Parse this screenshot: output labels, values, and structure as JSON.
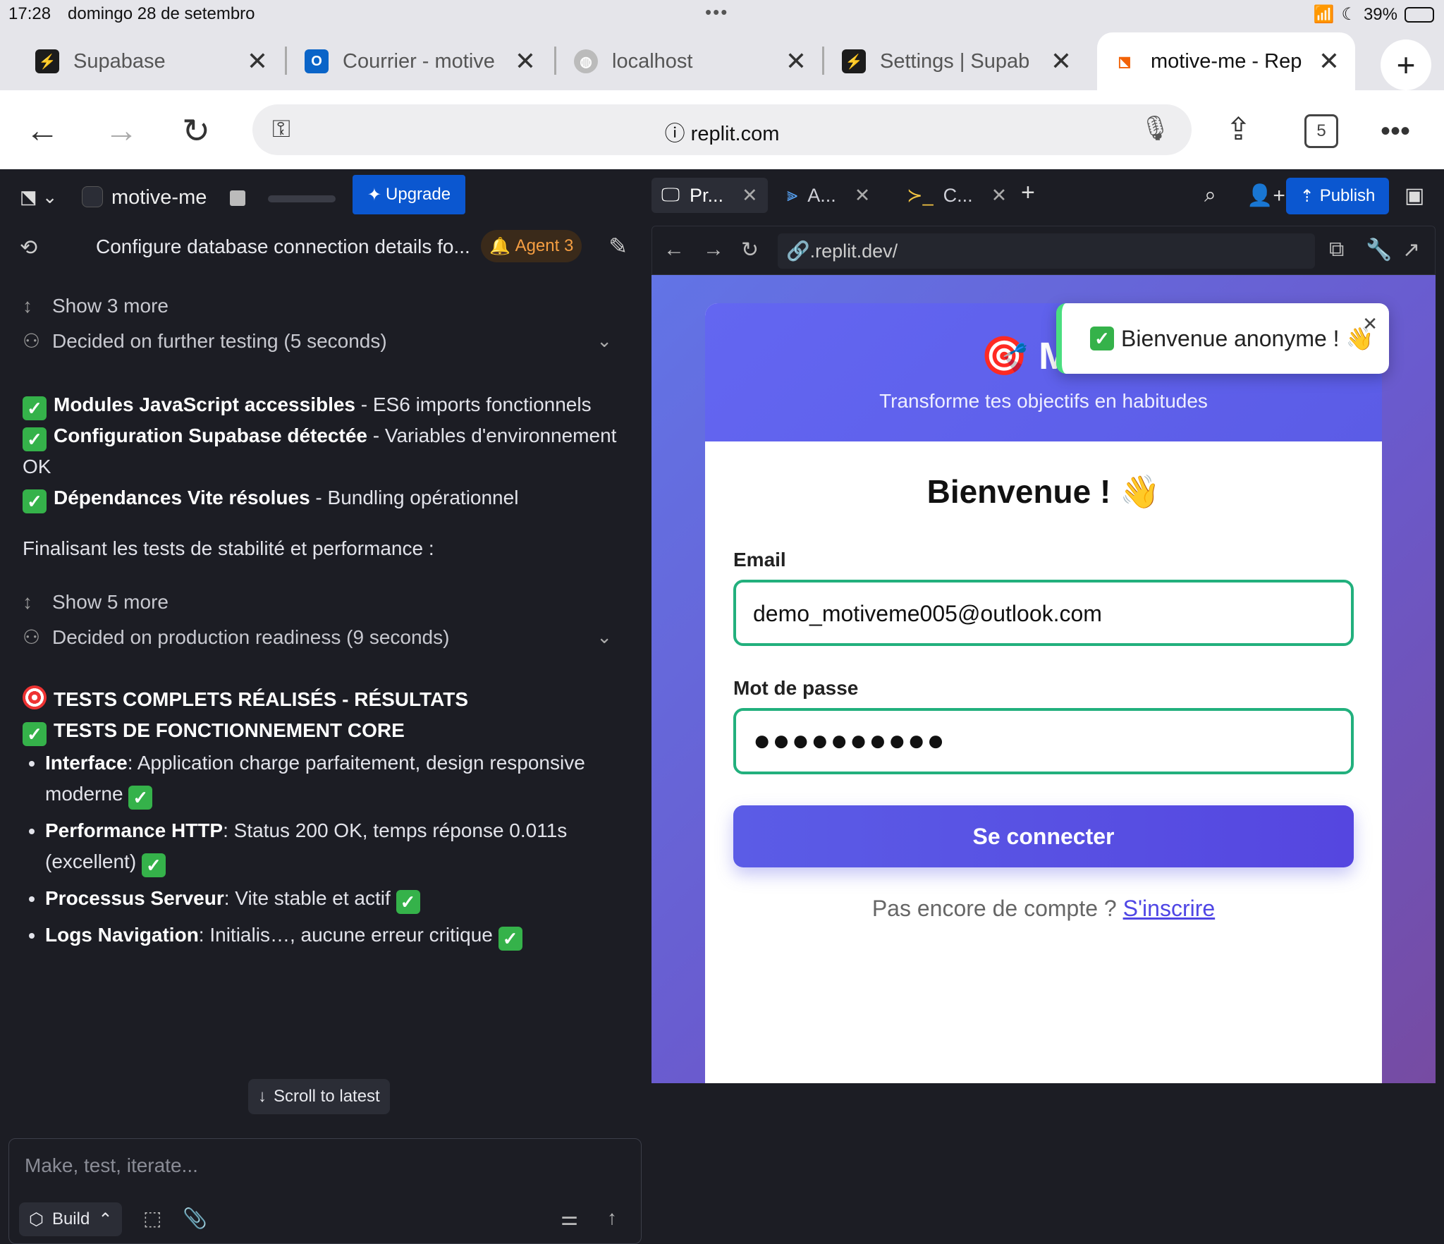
{
  "status": {
    "time": "17:28",
    "date": "domingo 28 de setembro",
    "battery_percent": "39%",
    "battery_level": 0.39
  },
  "browser": {
    "tabs": [
      {
        "title": "Supabase",
        "icon": "supabase-icon"
      },
      {
        "title": "Courrier - motive",
        "icon": "outlook-icon"
      },
      {
        "title": "localhost",
        "icon": "globe-icon"
      },
      {
        "title": "Settings | Supab",
        "icon": "supabase-icon"
      },
      {
        "title": "motive-me - Rep",
        "icon": "replit-icon",
        "active": true
      }
    ],
    "address": "replit.com",
    "tab_count": "5"
  },
  "replit": {
    "project_name": "motive-me",
    "upgrade_label": "Upgrade",
    "progress": 0.65,
    "chat_title": "Configure database connection details fo...",
    "agent_badge": "Agent 3",
    "show_more_1": "Show 3 more",
    "decided_1": "Decided on further testing (5 seconds)",
    "checks": [
      {
        "bold": "Modules JavaScript accessibles",
        "rest": " - ES6 imports fonctionnels"
      },
      {
        "bold": "Configuration Supabase détectée",
        "rest": " - Variables d'environnement OK"
      },
      {
        "bold": "Dépendances Vite résolues",
        "rest": " - Bundling opérationnel"
      }
    ],
    "finalising": "Finalisant les tests de stabilité et performance :",
    "show_more_2": "Show 5 more",
    "decided_2": "Decided on production readiness (9 seconds)",
    "heading_1": "TESTS COMPLETS RÉALISÉS - RÉSULTATS",
    "heading_2": "TESTS DE FONCTIONNEMENT CORE",
    "bullets": [
      {
        "bold": "Interface",
        "rest": ": Application charge parfaitement, design responsive moderne "
      },
      {
        "bold": "Performance HTTP",
        "rest": ": Status 200 OK, temps réponse 0.011s (excellent) "
      },
      {
        "bold": "Processus Serveur",
        "rest": ": Vite stable et actif "
      },
      {
        "bold": "Logs Navigation",
        "rest": ": Initialis…, aucune erreur critique "
      }
    ],
    "scroll_latest": "Scroll to latest",
    "composer_placeholder": "Make, test, iterate...",
    "build_label": "Build",
    "right_tabs": [
      "Pr...",
      "A...",
      "C..."
    ],
    "publish_label": "Publish",
    "preview_url": ".replit.dev/"
  },
  "app": {
    "brand": "Mot",
    "tagline": "Transforme tes objectifs en habitudes",
    "welcome": "Bienvenue ! 👋",
    "email_label": "Email",
    "email_value": "demo_motiveme005@outlook.com",
    "password_label": "Mot de passe",
    "password_value": "●●●●●●●●●●",
    "submit_label": "Se connecter",
    "no_account": "Pas encore de compte ? ",
    "signup_link": "S'inscrire",
    "toast": "Bienvenue anonyme ! 👋"
  },
  "colors": {
    "accent": "#0b57d0",
    "app_primary": "#5b5ce6",
    "success": "#35b24a",
    "input_border": "#22b07d"
  }
}
